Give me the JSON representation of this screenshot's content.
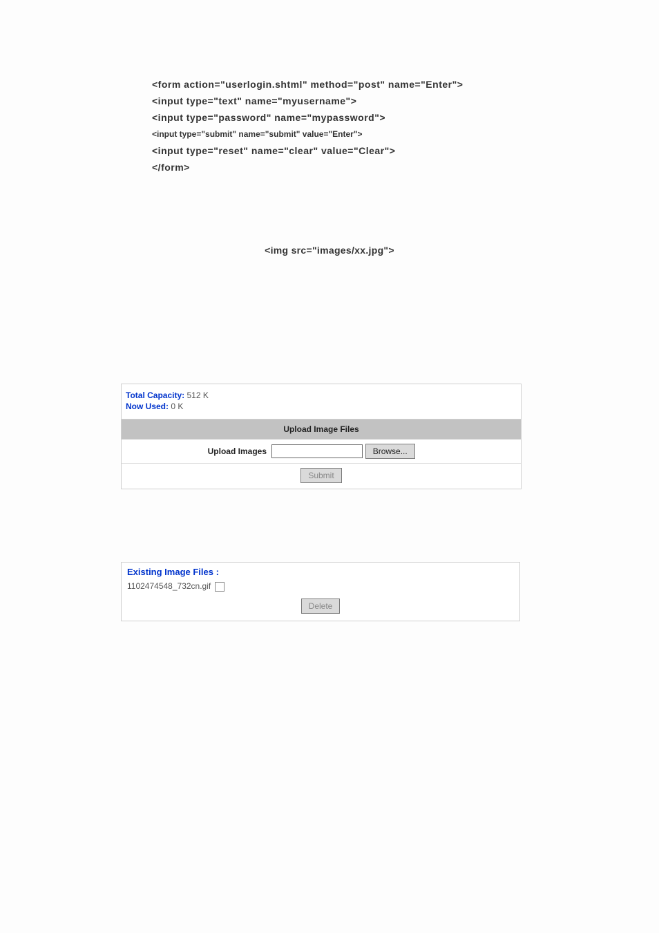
{
  "code": {
    "l1": "<form action=\"userlogin.shtml\" method=\"post\" name=\"Enter\">",
    "l2": "<input type=\"text\" name=\"myusername\">",
    "l3": "<input type=\"password\" name=\"mypassword\">",
    "l4": "<input type=\"submit\" name=\"submit\" value=\"Enter\">",
    "l5": "<input type=\"reset\" name=\"clear\" value=\"Clear\">",
    "l6": "</form>"
  },
  "img_line": "<img src=\"images/xx.jpg\">",
  "capacity": {
    "total_label": "Total Capacity:",
    "total_value": "512 K",
    "used_label": "Now Used:",
    "used_value": "0 K"
  },
  "upload": {
    "header": "Upload Image Files",
    "row_label": "Upload Images",
    "browse": "Browse...",
    "submit": "Submit"
  },
  "existing": {
    "heading": "Existing Image Files :",
    "file": "1102474548_732cn.gif",
    "delete": "Delete"
  }
}
